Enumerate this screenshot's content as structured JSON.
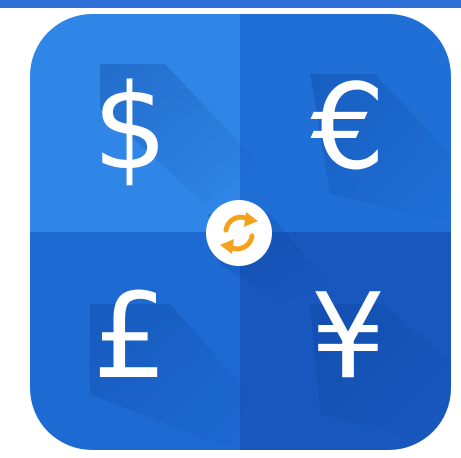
{
  "app_icon": {
    "symbols": {
      "top_left": "$",
      "top_right": "€",
      "bottom_left": "£",
      "bottom_right": "¥"
    },
    "center_icon": "swap-arrows-icon",
    "colors": {
      "top_bar": "#2f6fd8",
      "tile_top_left": "#2f86e6",
      "tile_top_right": "#1f6fd6",
      "tile_bottom_left": "#1d6ad2",
      "tile_bottom_right": "#1858be",
      "symbol": "#ffffff",
      "center_badge": "#ffffff",
      "swap_arrows": "#f4a11c"
    }
  }
}
